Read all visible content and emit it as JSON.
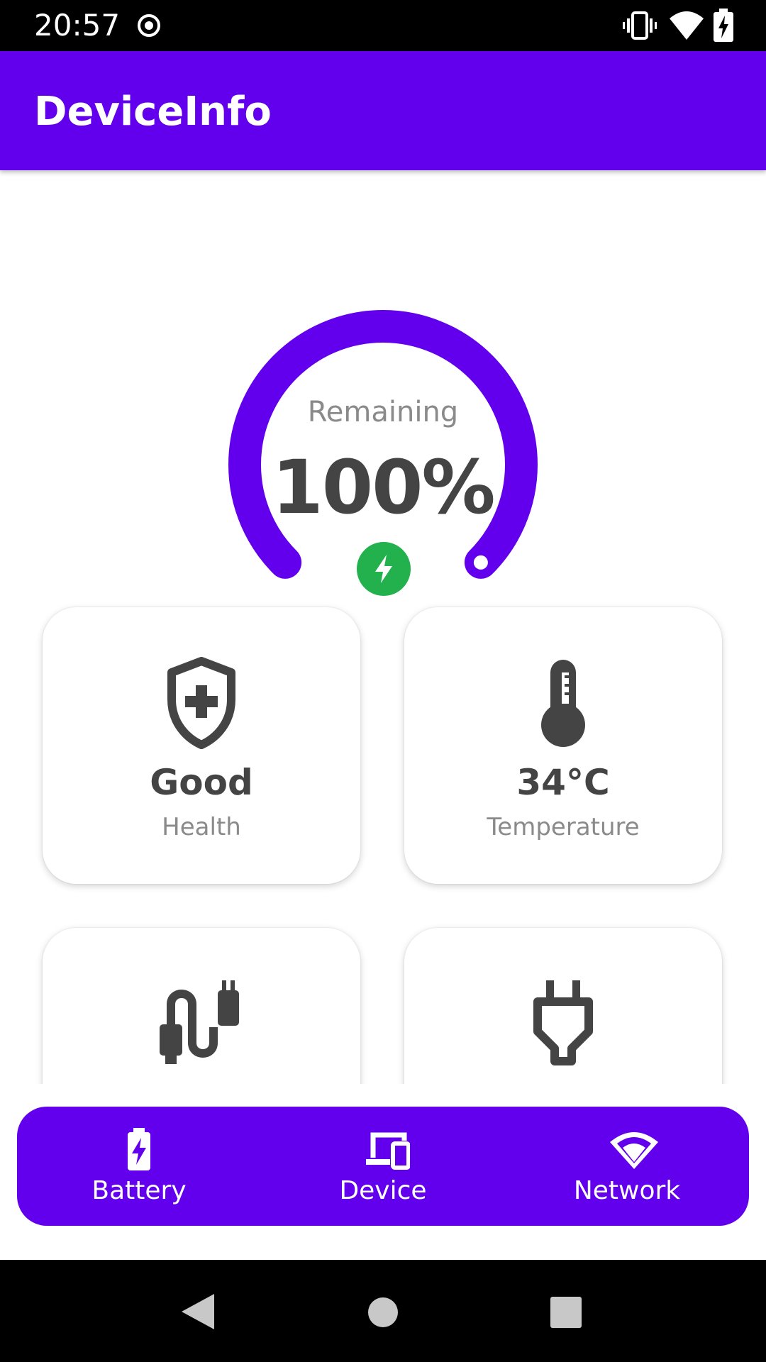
{
  "status_bar": {
    "time": "20:57",
    "icons": [
      "record-icon",
      "vibrate-icon",
      "wifi-icon",
      "battery-charging-icon"
    ]
  },
  "app_bar": {
    "title": "DeviceInfo",
    "color": "#6200EE"
  },
  "battery": {
    "remaining_label": "Remaining",
    "percent_text": "100%",
    "level": 1.0,
    "charging": true,
    "charging_color": "#22B14C"
  },
  "cards": [
    {
      "icon": "shield-plus-icon",
      "value": "Good",
      "label": "Health"
    },
    {
      "icon": "thermometer-icon",
      "value": "34°C",
      "label": "Temperature"
    },
    {
      "icon": "cable-icon",
      "value": "",
      "label": ""
    },
    {
      "icon": "power-plug-icon",
      "value": "",
      "label": ""
    }
  ],
  "bottom_nav": {
    "items": [
      {
        "icon": "battery-icon",
        "label": "Battery"
      },
      {
        "icon": "devices-icon",
        "label": "Device"
      },
      {
        "icon": "wifi-icon",
        "label": "Network"
      }
    ]
  },
  "system_nav": {
    "icons": [
      "back-icon",
      "home-icon",
      "recents-icon"
    ]
  },
  "colors": {
    "accent": "#6200EE",
    "text_dark": "#444444",
    "text_muted": "#8A8A8A"
  }
}
